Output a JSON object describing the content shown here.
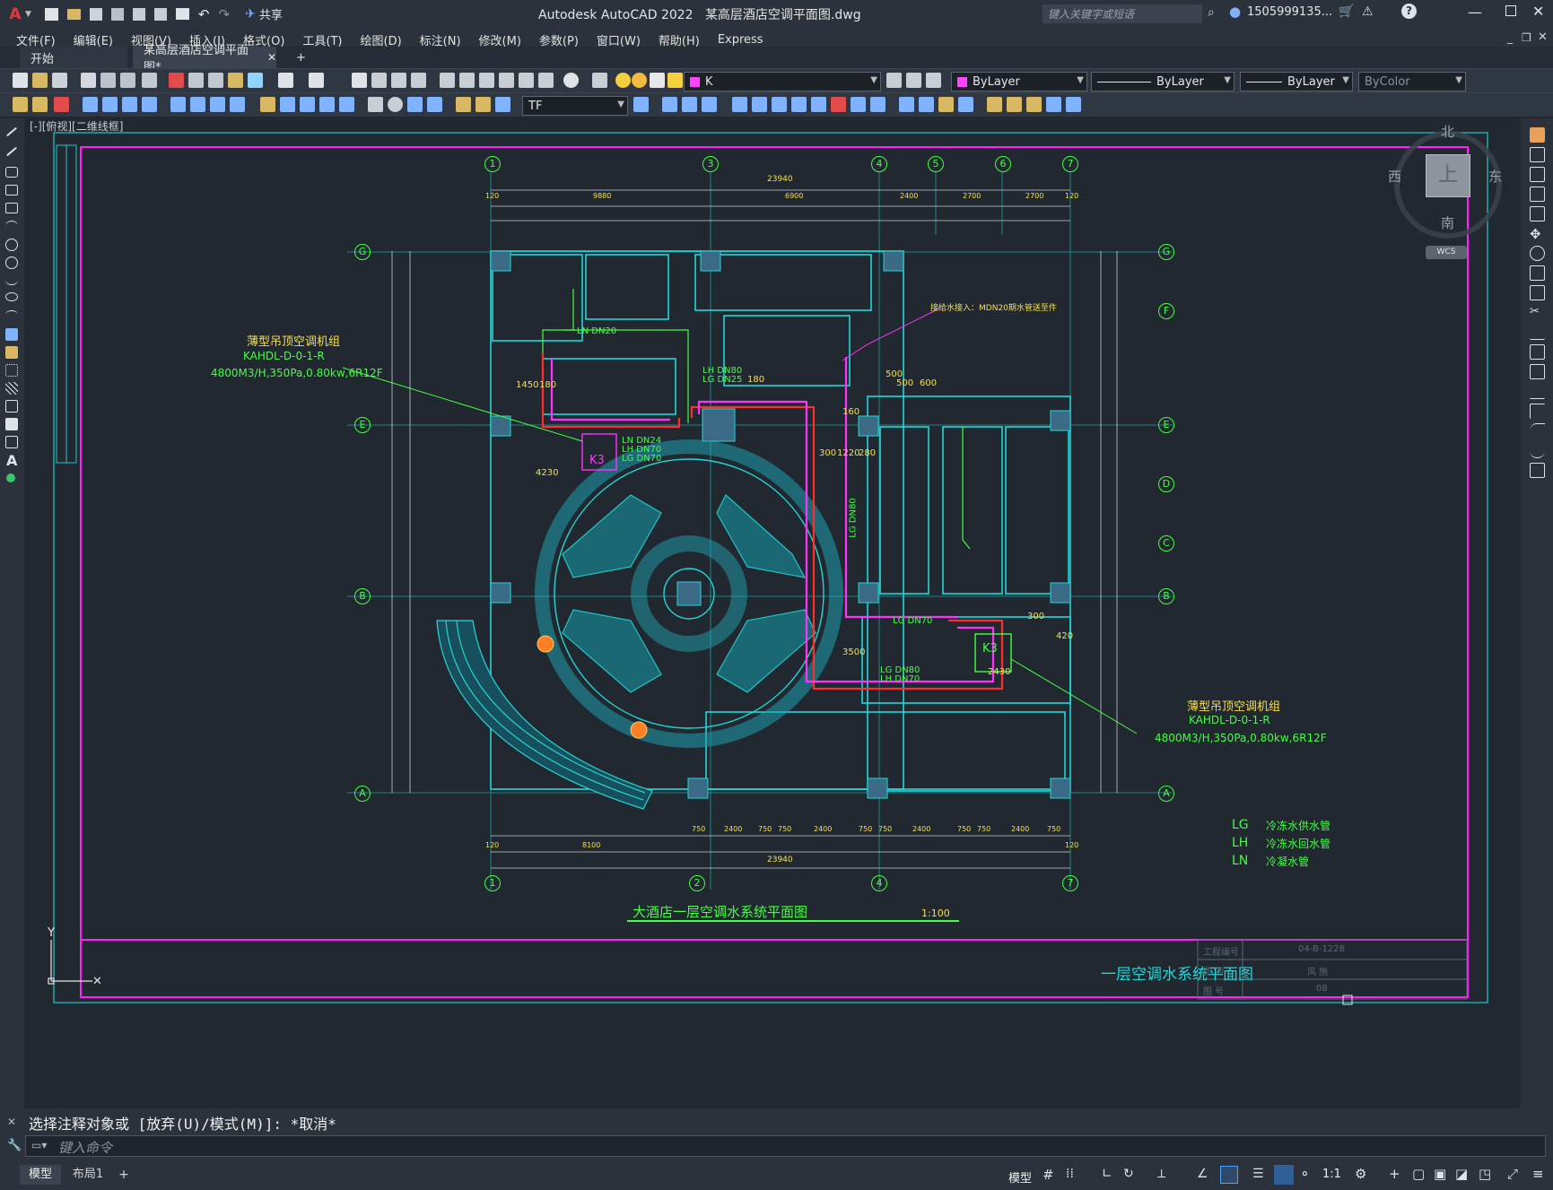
{
  "app": {
    "title": "Autodesk AutoCAD 2022",
    "document": "某高层酒店空调平面图.dwg",
    "search_placeholder": "键入关键字或短语",
    "user": "1505999135...",
    "share": "共享"
  },
  "menu": [
    "文件(F)",
    "编辑(E)",
    "视图(V)",
    "插入(I)",
    "格式(O)",
    "工具(T)",
    "绘图(D)",
    "标注(N)",
    "修改(M)",
    "参数(P)",
    "窗口(W)",
    "帮助(H)",
    "Express"
  ],
  "tabs": {
    "start": "开始",
    "active": "某高层酒店空调平面图*",
    "add": "+"
  },
  "toolbar": {
    "layer": "K",
    "color": "ByLayer",
    "linetype": "ByLayer",
    "lineweight": "ByLayer",
    "plotstyle": "ByColor",
    "textstyle": "TF"
  },
  "viewport_label": "[-][俯视][二维线框]",
  "viewcube": {
    "north": "北",
    "south": "南",
    "east": "东",
    "west": "西",
    "top": "上",
    "wcs": "WCS"
  },
  "drawing": {
    "title": "大酒店一层空调水系统平面图",
    "scale": "1:100",
    "sheet_title": "一层空调水系统平面图",
    "titleblock": [
      {
        "label": "工程编号",
        "value": "04-B-1228"
      },
      {
        "label": "图 别",
        "value": "风 施"
      },
      {
        "label": "图 号",
        "value": "08"
      }
    ],
    "legend": [
      {
        "code": "LG",
        "text": "冷冻水供水管"
      },
      {
        "code": "LH",
        "text": "冷冻水回水管"
      },
      {
        "code": "LN",
        "text": "冷凝水管"
      }
    ],
    "unit_left": [
      "薄型吊顶空调机组",
      "KAHDL-D-0-1-R",
      "4800M3/H,350Pa,0.80kw,6R12F"
    ],
    "unit_right": [
      "薄型吊顶空调机组",
      "KAHDL-D-0-1-R",
      "4800M3/H,350Pa,0.80kw,6R12F"
    ],
    "note_top": "接给水接入：MDN20期水管送至件",
    "axes_top": [
      "1",
      "3",
      "4",
      "5",
      "6",
      "7"
    ],
    "axes_bottom": [
      "1",
      "2",
      "4",
      "7"
    ],
    "axes_left": [
      "G",
      "E",
      "B",
      "A"
    ],
    "axes_right": [
      "G",
      "F",
      "E",
      "D",
      "C",
      "B",
      "A"
    ],
    "dims_top_total": "23940",
    "dims_bottom_total": "23940",
    "dims_top": [
      "120",
      "9880",
      "6900",
      "2400",
      "2700",
      "2700",
      "120"
    ],
    "dims_bottom": [
      "120",
      "8100",
      "750",
      "2400",
      "750",
      "750",
      "2400",
      "750",
      "750",
      "2400",
      "750",
      "750",
      "2400",
      "750",
      "120"
    ],
    "pipe_labels": [
      "LH DN80",
      "LG DN25",
      "LN DN20",
      "LN DN24",
      "LH DN70",
      "LG DN70",
      "LG DN80",
      "LH DN70",
      "LG DN70",
      "LG DN80"
    ],
    "unit_tag": "K3",
    "dims_misc": [
      "1450",
      "180",
      "4230",
      "500",
      "600",
      "500",
      "300",
      "1220",
      "280",
      "160",
      "3500",
      "2430",
      "420",
      "300",
      "180"
    ]
  },
  "command": {
    "history": "选择注释对象或 [放弃(U)/模式(M)]: *取消*",
    "placeholder": "键入命令"
  },
  "status": {
    "model_tab": "模型",
    "layout_tab": "布局1",
    "add": "+",
    "model": "模型",
    "scale": "1:1"
  }
}
